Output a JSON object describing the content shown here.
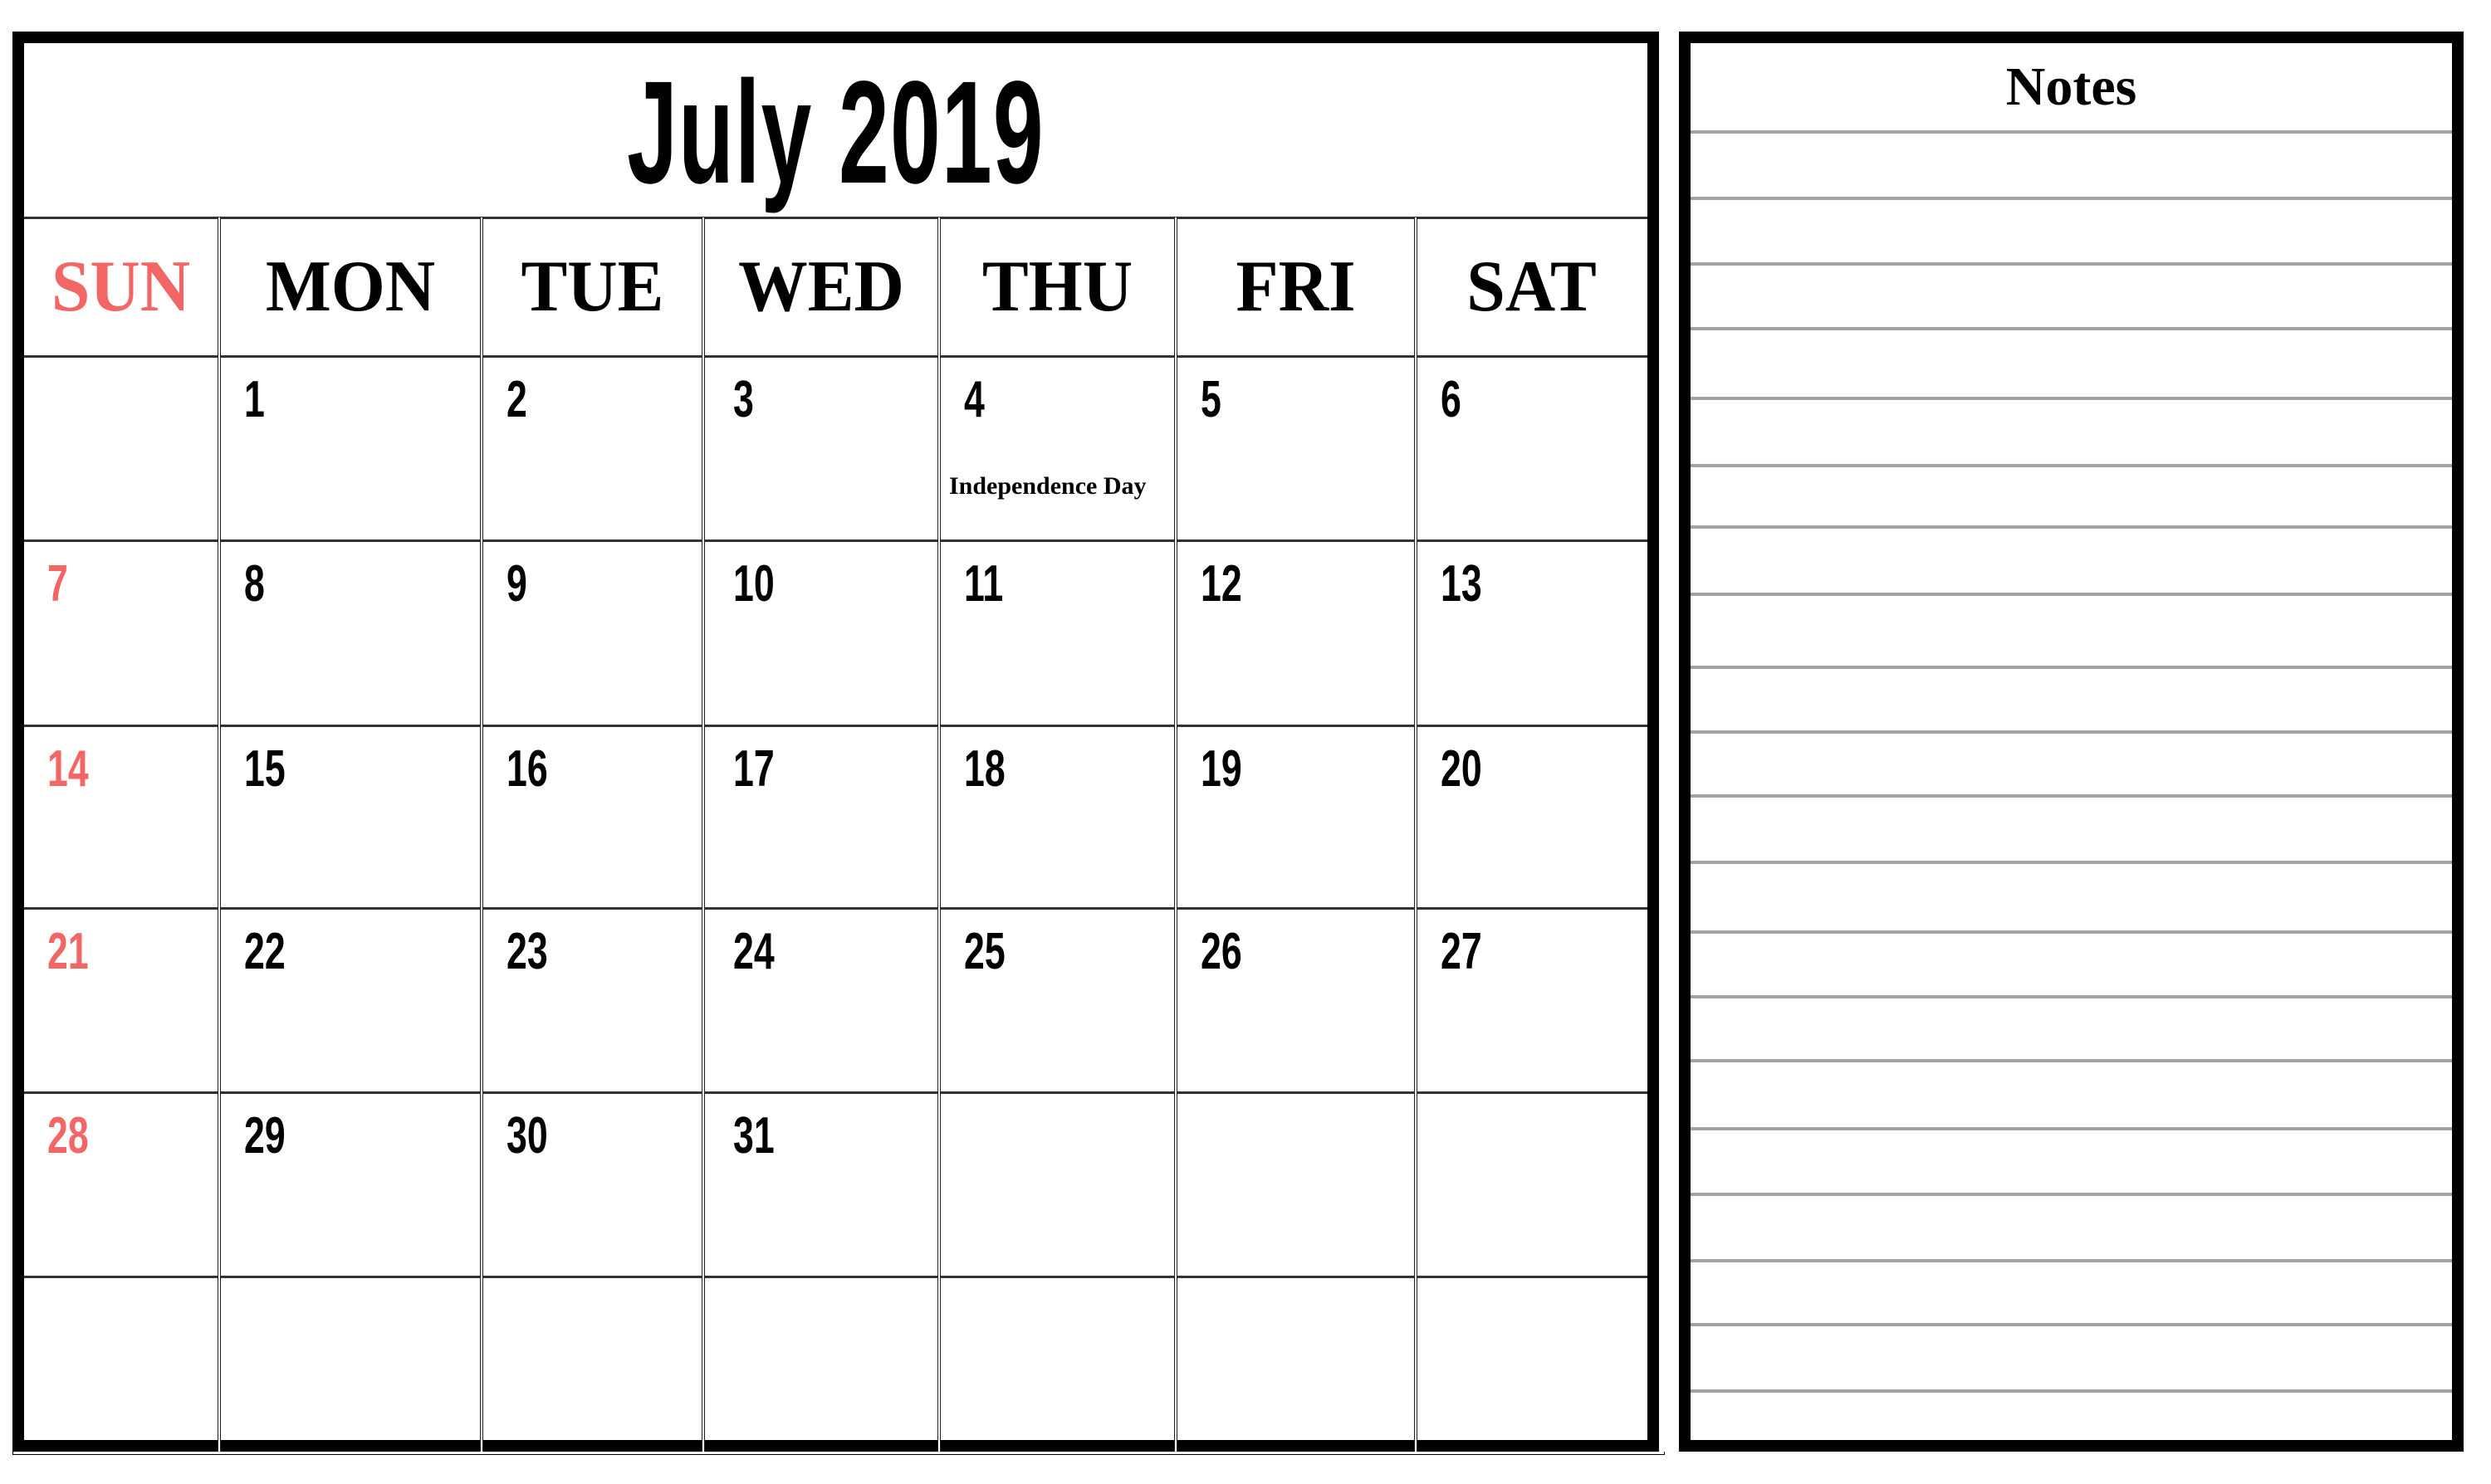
{
  "calendar": {
    "title": "July 2019",
    "weekdays": [
      "SUN",
      "MON",
      "TUE",
      "WED",
      "THU",
      "FRI",
      "SAT"
    ],
    "weeks": [
      [
        "",
        "1",
        "2",
        "3",
        "4",
        "5",
        "6"
      ],
      [
        "7",
        "8",
        "9",
        "10",
        "11",
        "12",
        "13"
      ],
      [
        "14",
        "15",
        "16",
        "17",
        "18",
        "19",
        "20"
      ],
      [
        "21",
        "22",
        "23",
        "24",
        "25",
        "26",
        "27"
      ],
      [
        "28",
        "29",
        "30",
        "31",
        "",
        "",
        ""
      ],
      [
        "",
        "",
        "",
        "",
        "",
        "",
        ""
      ]
    ],
    "holidays": [
      {
        "day": "4",
        "label": "Independence Day"
      }
    ],
    "sunday_color": "#f26666",
    "text_color": "#000000"
  },
  "notes": {
    "title": "Notes",
    "line_count": 20,
    "line_color": "#a3a3a3"
  }
}
